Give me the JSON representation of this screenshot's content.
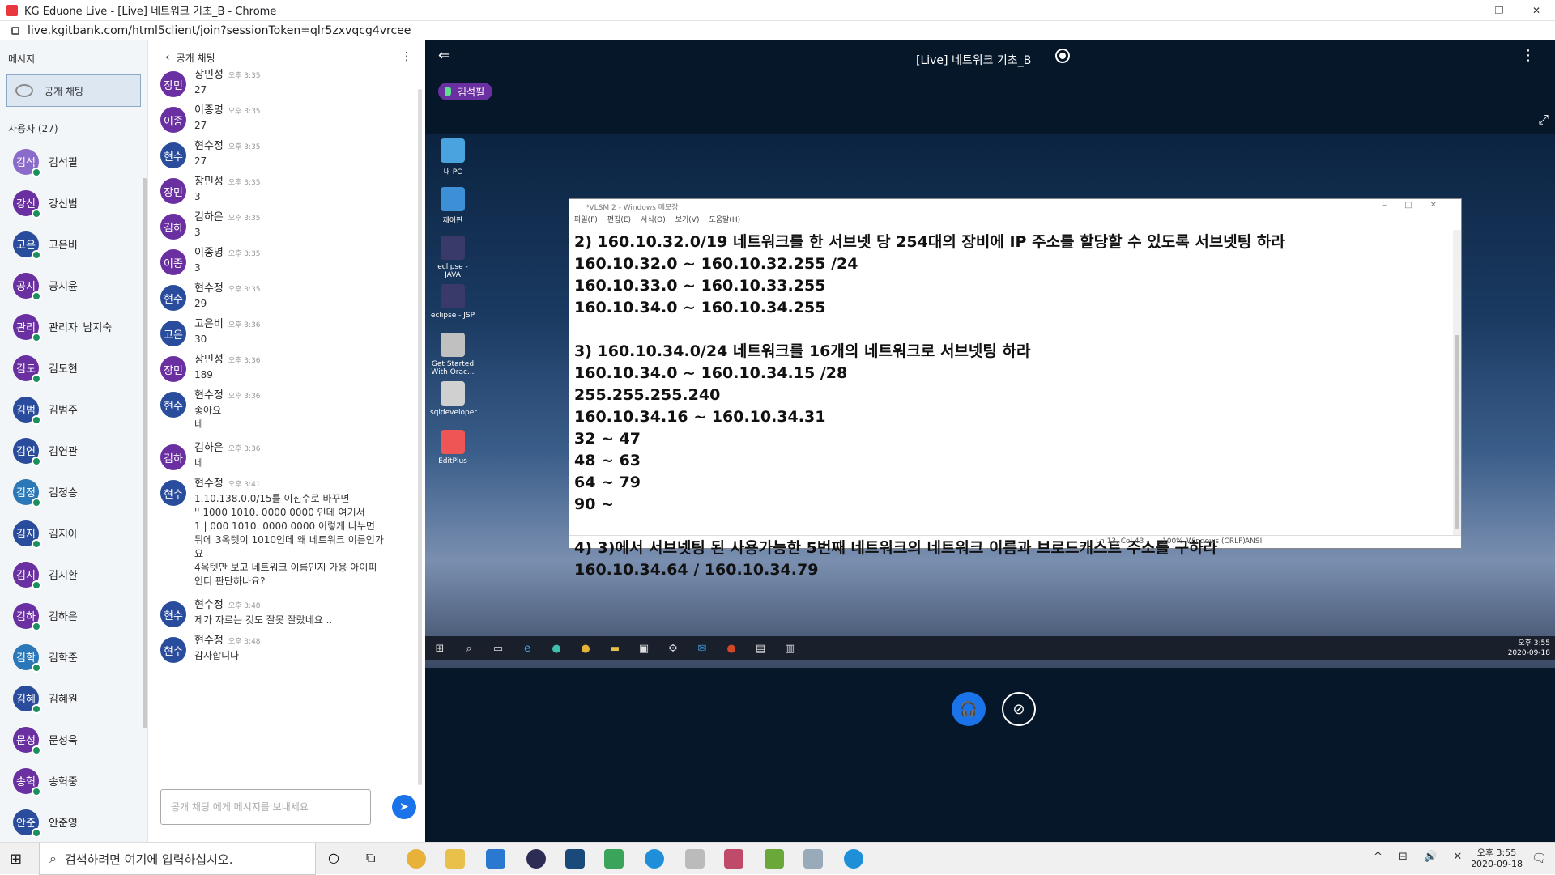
{
  "window": {
    "title": "KG Eduone Live - [Live] 네트워크 기초_B - Chrome",
    "url": "live.kgitbank.com/html5client/join?sessionToken=qlr5zxvqcg4vrcee",
    "minimize": "—",
    "maximize": "❐",
    "close": "✕"
  },
  "left": {
    "messages_label": "메시지",
    "public_chat_label": "공개 채팅",
    "users_label": "사용자 (27)",
    "users": [
      {
        "short": "김석",
        "name": "김석필",
        "color": "#8b6bc9"
      },
      {
        "short": "강신",
        "name": "강신범",
        "color": "#6a2fa0"
      },
      {
        "short": "고은",
        "name": "고은비",
        "color": "#2a4c9c"
      },
      {
        "short": "공지",
        "name": "공지윤",
        "color": "#6a2fa0"
      },
      {
        "short": "관리",
        "name": "관리자_남지숙",
        "color": "#6a2fa0"
      },
      {
        "short": "김도",
        "name": "김도현",
        "color": "#6a2fa0"
      },
      {
        "short": "김범",
        "name": "김범주",
        "color": "#2a4c9c"
      },
      {
        "short": "김연",
        "name": "김연관",
        "color": "#2a4c9c"
      },
      {
        "short": "김정",
        "name": "김정승",
        "color": "#2a78b8"
      },
      {
        "short": "김지",
        "name": "김지아",
        "color": "#2a4c9c"
      },
      {
        "short": "김지",
        "name": "김지환",
        "color": "#6a2fa0"
      },
      {
        "short": "김하",
        "name": "김하은",
        "color": "#6a2fa0"
      },
      {
        "short": "김학",
        "name": "김학준",
        "color": "#2a78b8"
      },
      {
        "short": "김혜",
        "name": "김혜원",
        "color": "#2a4c9c"
      },
      {
        "short": "문성",
        "name": "문성욱",
        "color": "#6a2fa0"
      },
      {
        "short": "송혁",
        "name": "송혁중",
        "color": "#6a2fa0"
      },
      {
        "short": "안준",
        "name": "안준영",
        "color": "#2a4c9c"
      }
    ]
  },
  "chat": {
    "header": "공개 채팅",
    "back_icon": "‹",
    "more_icon": "⋮",
    "messages": [
      {
        "short": "장민",
        "name": "장민성",
        "time": "오후 3:35",
        "lines": [
          "27"
        ],
        "color": "#6a2fa0"
      },
      {
        "short": "이종",
        "name": "이종명",
        "time": "오후 3:35",
        "lines": [
          "27"
        ],
        "color": "#6a2fa0"
      },
      {
        "short": "현수",
        "name": "현수정",
        "time": "오후 3:35",
        "lines": [
          "27"
        ],
        "color": "#2a4c9c"
      },
      {
        "short": "장민",
        "name": "장민성",
        "time": "오후 3:35",
        "lines": [
          "3"
        ],
        "color": "#6a2fa0"
      },
      {
        "short": "김하",
        "name": "김하은",
        "time": "오후 3:35",
        "lines": [
          "3"
        ],
        "color": "#6a2fa0"
      },
      {
        "short": "이종",
        "name": "이종명",
        "time": "오후 3:35",
        "lines": [
          "3"
        ],
        "color": "#6a2fa0"
      },
      {
        "short": "현수",
        "name": "현수정",
        "time": "오후 3:35",
        "lines": [
          "29"
        ],
        "color": "#2a4c9c"
      },
      {
        "short": "고은",
        "name": "고은비",
        "time": "오후 3:36",
        "lines": [
          "30"
        ],
        "color": "#2a4c9c"
      },
      {
        "short": "장민",
        "name": "장민성",
        "time": "오후 3:36",
        "lines": [
          "189"
        ],
        "color": "#6a2fa0"
      },
      {
        "short": "현수",
        "name": "현수정",
        "time": "오후 3:36",
        "lines": [
          "좋아요",
          "네"
        ],
        "color": "#2a4c9c"
      },
      {
        "short": "김하",
        "name": "김하은",
        "time": "오후 3:36",
        "lines": [
          "네"
        ],
        "color": "#6a2fa0"
      },
      {
        "short": "현수",
        "name": "현수정",
        "time": "오후 3:41",
        "lines": [
          "1.10.138.0.0/15를 이진수로 바꾸면",
          "'' 1000 1010. 0000 0000 인데 여기서",
          "1 | 000 1010. 0000 0000 이렇게 나누면",
          "뒤에 3옥텟이 1010인데 왜 네트워크 이름인가",
          "요",
          "4옥텟만 보고 네트워크 이름인지 가용 아이피",
          "인디 판단하나요?"
        ],
        "color": "#2a4c9c"
      },
      {
        "short": "현수",
        "name": "현수정",
        "time": "오후 3:48",
        "lines": [
          "제가 자르는 것도 잘못 잘랐네요 .."
        ],
        "color": "#2a4c9c"
      },
      {
        "short": "현수",
        "name": "현수정",
        "time": "오후 3:48",
        "lines": [
          "감사합니다"
        ],
        "color": "#2a4c9c"
      }
    ],
    "input_placeholder": "공개 채팅 에게 메시지를 보내세요",
    "send_icon": "➤"
  },
  "main": {
    "title": "[Live] 네트워크 기초_B",
    "presenter": "김석필",
    "back_icon": "⇐",
    "more_icon": "⋮",
    "fullscreen_icon": "⤢",
    "desktop_icons": [
      {
        "label": "내 PC",
        "color": "#4aa3df"
      },
      {
        "label": "제어판",
        "color": "#3d8fd6"
      },
      {
        "label": "eclipse - JAVA",
        "color": "#3a3a6a"
      },
      {
        "label": "eclipse - JSP",
        "color": "#3a3a6a"
      },
      {
        "label": "Get Started With Orac...",
        "color": "#c0c0c0"
      },
      {
        "label": "sqldeveloper",
        "color": "#d0d0d0"
      },
      {
        "label": "EditPlus",
        "color": "#e55"
      }
    ],
    "notepad": {
      "title": "*VLSM 2 - Windows 메모장",
      "menu": [
        "파일(F)",
        "편집(E)",
        "서식(O)",
        "보기(V)",
        "도움말(H)"
      ],
      "lines": [
        "2) 160.10.32.0/19 네트워크를 한 서브넷 당 254대의 장비에 IP 주소를 할당할 수 있도록 서브넷팅 하라",
        "160.10.32.0 ~ 160.10.32.255 /24",
        "160.10.33.0 ~ 160.10.33.255",
        "160.10.34.0 ~ 160.10.34.255",
        "",
        "3) 160.10.34.0/24 네트워크를 16개의 네트워크로 서브넷팅 하라",
        "160.10.34.0 ~ 160.10.34.15 /28",
        "255.255.255.240",
        "160.10.34.16 ~ 160.10.34.31",
        "32 ~ 47",
        "48 ~ 63",
        "64 ~ 79",
        "90 ~",
        "",
        "4) 3)에서 서브넷팅 된 사용가능한 5번째 네트워크의 네트워크 이름과 브로드캐스트 주소를 구하라",
        "160.10.34.64  / 160.10.34.79"
      ],
      "status_pos": "Ln 13, Col 43",
      "status_zoom": "100%",
      "status_eol": "Windows (CRLF)",
      "status_enc": "ANSI"
    },
    "remote_clock_time": "오후 3:55",
    "remote_clock_date": "2020-09-18",
    "headset_icon": "🎧",
    "camera_icon": "⊘"
  },
  "taskbar": {
    "start_icon": "⊞",
    "search_placeholder": "검색하려면 여기에 입력하십시오.",
    "search_icon": "⌕",
    "clock_time": "오후 3:55",
    "clock_date": "2020-09-18",
    "tray": "^ ⊟ 🔊 ✕",
    "notif_icon": "🗨"
  }
}
